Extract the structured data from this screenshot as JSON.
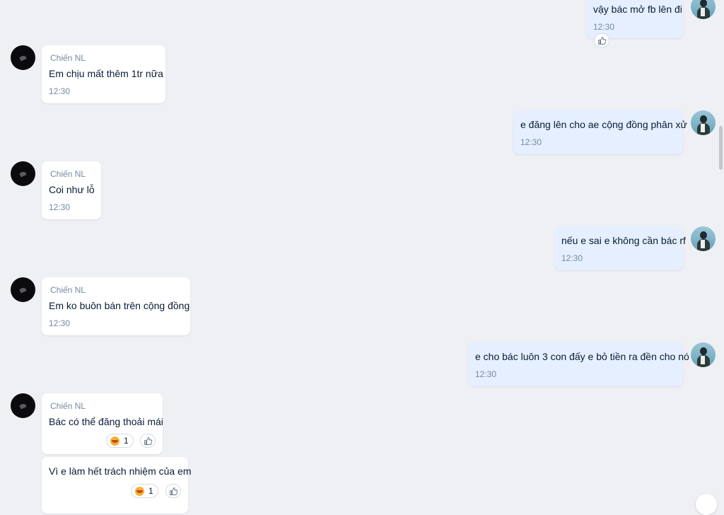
{
  "conversation": {
    "self_messages": [
      {
        "text": "vậy bác mở fb lên đi",
        "time": "12:30"
      },
      {
        "text": "e đăng lên cho ae cộng đồng phân xử",
        "time": "12:30"
      },
      {
        "text": "nếu e sai e không cần bác rf",
        "time": "12:30"
      },
      {
        "text": "e cho bác luôn 3 con đấy e bỏ tiền ra đền cho nó",
        "time": "12:30"
      }
    ],
    "other_messages": [
      {
        "sender": "Chiến NL",
        "text": "Em chịu mất thêm 1tr nữa",
        "time": "12:30"
      },
      {
        "sender": "Chiến NL",
        "text": "Coi như lỗ",
        "time": "12:30"
      },
      {
        "sender": "Chiến NL",
        "text": "Em ko buôn bán trên cộng đồng",
        "time": "12:30"
      },
      {
        "sender": "Chiến NL",
        "text": "Bác có thể đăng thoải mái",
        "reaction_count": "1"
      },
      {
        "text": "Vì e làm hết trách nhiệm của em",
        "reaction_count": "1"
      }
    ]
  },
  "icons": {
    "like": "thumbs-up-icon",
    "reaction": "haha-emoji-icon"
  },
  "colors": {
    "background": "#eef0f4",
    "self_bubble": "#e5efff",
    "other_bubble": "#ffffff",
    "meta_text": "#7589a3"
  }
}
